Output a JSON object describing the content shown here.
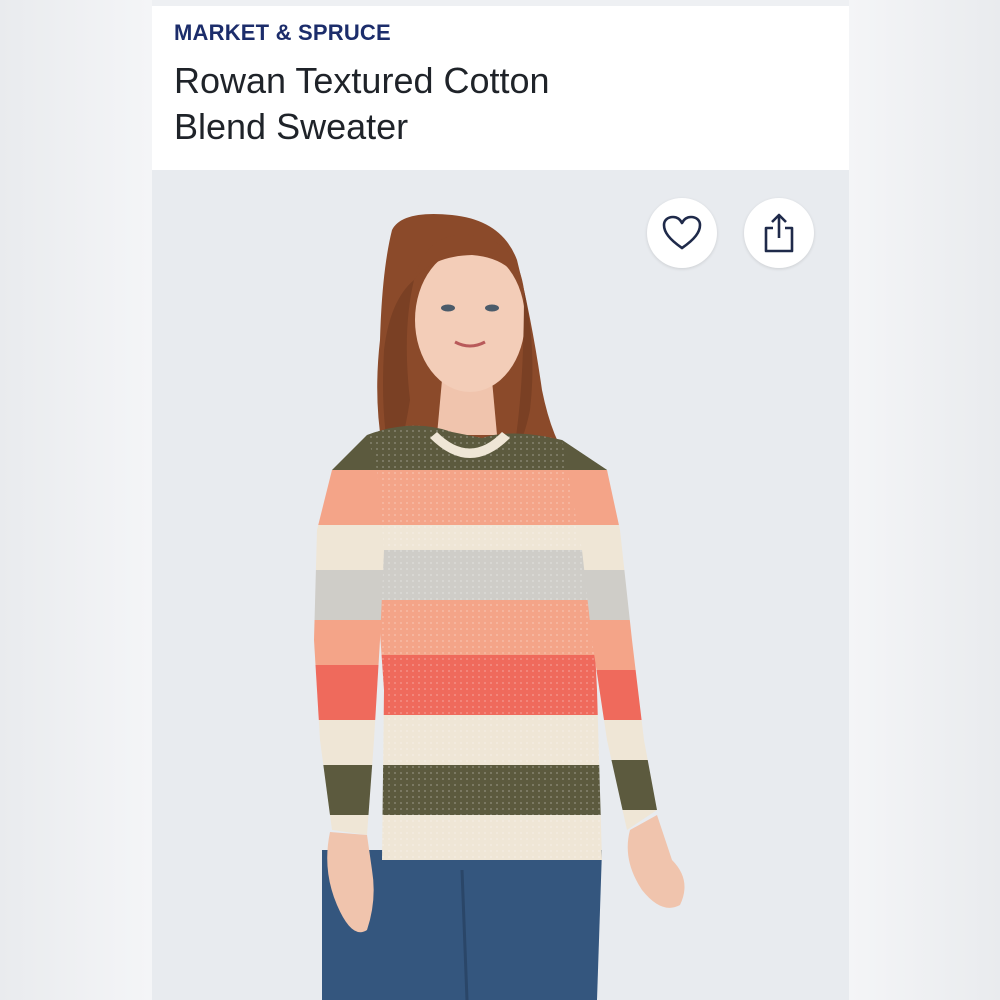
{
  "product": {
    "brand": "MARKET & SPRUCE",
    "title_line1": "Rowan Textured Cotton",
    "title_line2": "Blend Sweater"
  },
  "actions": {
    "favorite_icon": "heart-icon",
    "share_icon": "share-icon"
  },
  "colors": {
    "brand_text": "#1c2d6b",
    "title_text": "#1f2329",
    "photo_bg": "#e8ebef",
    "stripe_olive": "#5c5a3e",
    "stripe_peach": "#f4a488",
    "stripe_cream": "#efe6d6",
    "stripe_gray": "#cfcdc8",
    "stripe_coral": "#ef6a5c",
    "denim": "#34567e",
    "hair": "#8b4a2a"
  }
}
